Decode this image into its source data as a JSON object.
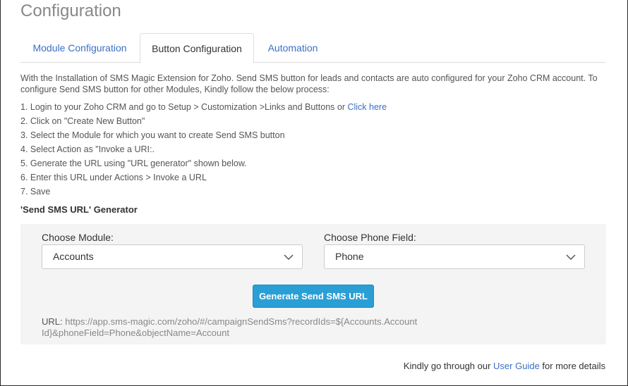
{
  "page": {
    "title": "Configuration"
  },
  "tabs": [
    {
      "label": "Module Configuration",
      "active": false
    },
    {
      "label": "Button Configuration",
      "active": true
    },
    {
      "label": "Automation",
      "active": false
    }
  ],
  "intro": "With the Installation of SMS Magic Extension for Zoho. Send SMS button for leads and contacts are auto configured for your Zoho CRM account. To configure Send SMS button for other Modules, Kindly follow the below process:",
  "steps": {
    "s1_text": "1. Login to your Zoho CRM and go to Setup > Customization >Links and Buttons or ",
    "s1_link": "Click here",
    "s2": "2. Click on \"Create New Button\"",
    "s3": "3. Select the Module for which you want to create Send SMS button",
    "s4": "4. Select Action as \"Invoke a URI:.",
    "s5": "5. Generate the URL using \"URL generator\" shown below.",
    "s6": "6. Enter this URL under Actions > Invoke a URL",
    "s7": "7. Save"
  },
  "generator": {
    "title": "'Send SMS URL' Generator",
    "module_label": "Choose Module:",
    "module_value": "Accounts",
    "phone_label": "Choose Phone Field:",
    "phone_value": "Phone",
    "button_label": "Generate Send SMS URL",
    "url_label": "URL:",
    "url_value": "https://app.sms-magic.com/zoho/#/campaignSendSms?recordIds=${Accounts.Account Id}&phoneField=Phone&objectName=Account"
  },
  "footer": {
    "prefix": "Kindly go through our ",
    "link": "User Guide",
    "suffix": " for more details"
  },
  "colors": {
    "link": "#3b6fc8",
    "button": "#2a9fd6",
    "panel": "#f4f4f4"
  },
  "icons": {
    "select_arrow": "chevron-down-icon"
  }
}
